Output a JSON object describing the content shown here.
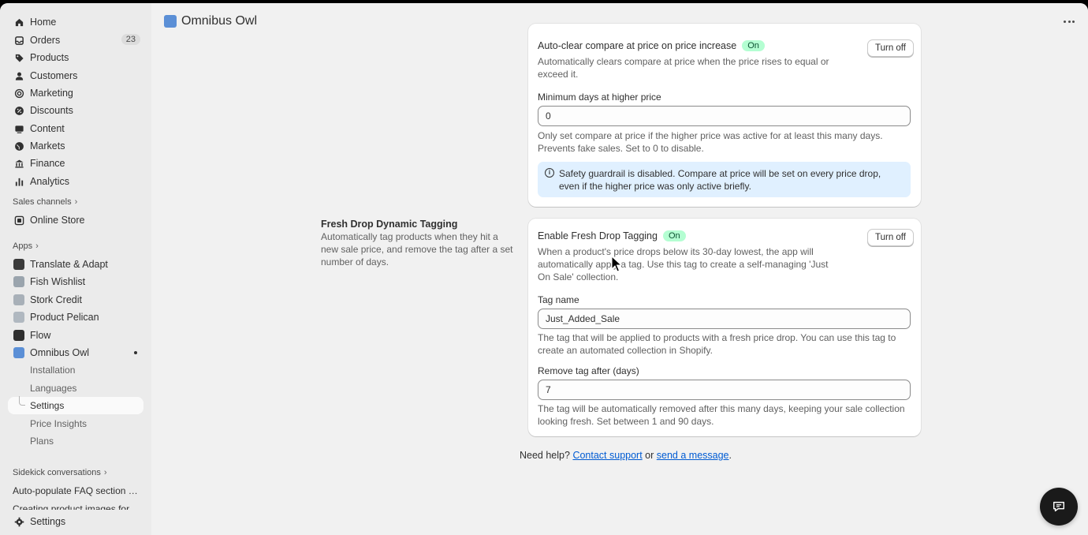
{
  "sidebar": {
    "items": [
      {
        "label": "Home",
        "icon": "home-icon"
      },
      {
        "label": "Orders",
        "icon": "orders-icon",
        "badge": "23"
      },
      {
        "label": "Products",
        "icon": "tag-icon"
      },
      {
        "label": "Customers",
        "icon": "person-icon"
      },
      {
        "label": "Marketing",
        "icon": "target-icon"
      },
      {
        "label": "Discounts",
        "icon": "discount-icon"
      },
      {
        "label": "Content",
        "icon": "content-icon"
      },
      {
        "label": "Markets",
        "icon": "globe-icon"
      },
      {
        "label": "Finance",
        "icon": "bank-icon"
      },
      {
        "label": "Analytics",
        "icon": "chart-icon"
      }
    ],
    "sales_channels_title": "Sales channels",
    "online_store": "Online Store",
    "apps_title": "Apps",
    "apps": [
      {
        "label": "Translate & Adapt",
        "color": "#3a3a3a"
      },
      {
        "label": "Fish Wishlist",
        "color": "#9aa4ad"
      },
      {
        "label": "Stork Credit",
        "color": "#a8b0b8"
      },
      {
        "label": "Product Pelican",
        "color": "#b0b8c0"
      },
      {
        "label": "Flow",
        "color": "#2f2f2f"
      },
      {
        "label": "Omnibus Owl",
        "color": "#5b8fd6"
      }
    ],
    "sub_items": [
      "Installation",
      "Languages",
      "Settings",
      "Price Insights",
      "Plans"
    ],
    "sidekick_title": "Sidekick conversations",
    "conversations": [
      "Auto-populate FAQ section fro...",
      "Creating product images for p..."
    ],
    "bottom_settings": "Settings"
  },
  "header": {
    "title": "Omnibus Owl"
  },
  "autoclear": {
    "label": "Auto-clear compare at price on price increase",
    "badge": "On",
    "button": "Turn off",
    "help": "Automatically clears compare at price when the price rises to equal or exceed it.",
    "min_days_label": "Minimum days at higher price",
    "min_days_value": "0",
    "min_days_help": "Only set compare at price if the higher price was active for at least this many days. Prevents fake sales. Set to 0 to disable.",
    "banner": "Safety guardrail is disabled. Compare at price will be set on every price drop, even if the higher price was only active briefly."
  },
  "fresh_drop": {
    "section_title": "Fresh Drop Dynamic Tagging",
    "section_desc": "Automatically tag products when they hit a new sale price, and remove the tag after a set number of days.",
    "label": "Enable Fresh Drop Tagging",
    "badge": "On",
    "button": "Turn off",
    "help": "When a product's price drops below its 30-day lowest, the app will automatically apply a tag. Use this tag to create a self-managing 'Just On Sale' collection.",
    "tag_name_label": "Tag name",
    "tag_name_value": "Just_Added_Sale",
    "tag_name_help": "The tag that will be applied to products with a fresh price drop. You can use this tag to create an automated collection in Shopify.",
    "remove_label": "Remove tag after (days)",
    "remove_value": "7",
    "remove_help": "The tag will be automatically removed after this many days, keeping your sale collection looking fresh. Set between 1 and 90 days."
  },
  "footer": {
    "prefix": "Need help?",
    "contact": "Contact support",
    "or": "or",
    "message": "send a message",
    "suffix": "."
  },
  "colors": {
    "accent_link": "#005bd3",
    "badge_on_bg": "#b4fed2",
    "banner_bg": "#e0f0ff"
  }
}
